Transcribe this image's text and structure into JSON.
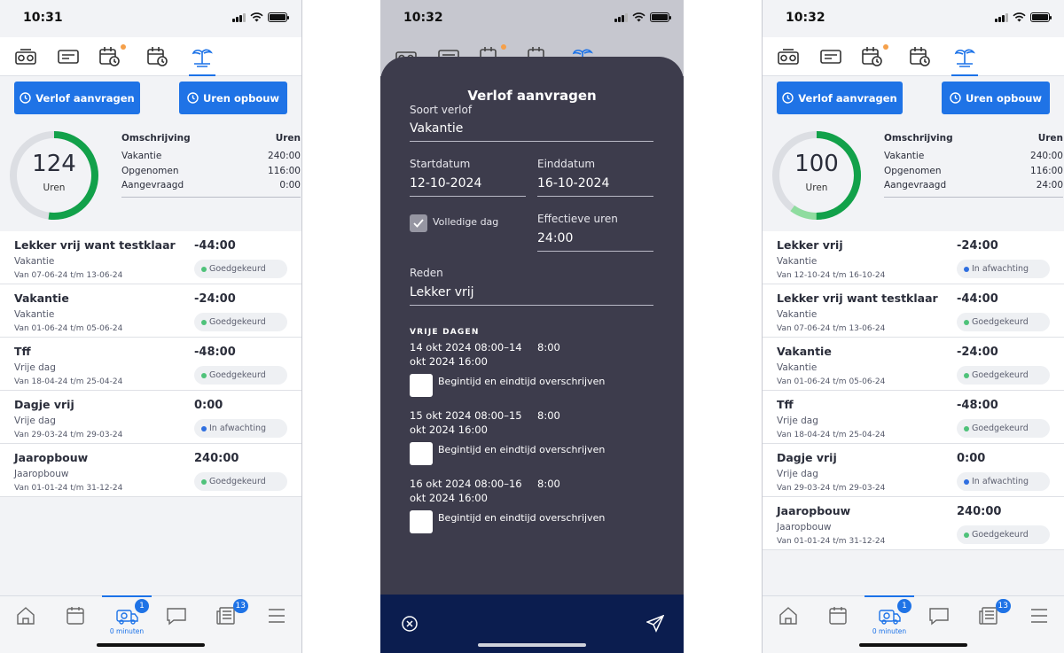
{
  "screens": [
    {
      "time": "10:31",
      "buttons": {
        "request": "Verlof aanvragen",
        "accrual": "Uren opbouw"
      },
      "ring": {
        "value": "124",
        "label": "Uren",
        "progress": 0.52
      },
      "table": {
        "header": {
          "desc": "Omschrijving",
          "hours": "Uren"
        },
        "rows": [
          {
            "label": "Vakantie",
            "value": "240:00"
          },
          {
            "label": "Opgenomen",
            "value": "116:00"
          },
          {
            "label": "Aangevraagd",
            "value": "0:00"
          }
        ]
      },
      "items": [
        {
          "title": "Lekker vrij want testklaar",
          "type": "Vakantie",
          "dates": "Van 07-06-24 t/m 13-06-24",
          "value": "-44:00",
          "status": "Goedgekeurd",
          "color": "#4fc27a"
        },
        {
          "title": "Vakantie",
          "type": "Vakantie",
          "dates": "Van 01-06-24 t/m 05-06-24",
          "value": "-24:00",
          "status": "Goedgekeurd",
          "color": "#4fc27a"
        },
        {
          "title": "Tff",
          "type": "Vrije dag",
          "dates": "Van 18-04-24 t/m 25-04-24",
          "value": "-48:00",
          "status": "Goedgekeurd",
          "color": "#4fc27a"
        },
        {
          "title": "Dagje vrij",
          "type": "Vrije dag",
          "dates": "Van 29-03-24 t/m 29-03-24",
          "value": "0:00",
          "status": "In afwachting",
          "color": "#2f6fe0"
        },
        {
          "title": "Jaaropbouw",
          "type": "Jaaropbouw",
          "dates": "Van 01-01-24 t/m 31-12-24",
          "value": "240:00",
          "status": "Goedgekeurd",
          "color": "#4fc27a"
        }
      ],
      "tabbar": {
        "badge_clock": "1",
        "clock_label": "0 minuten",
        "badge_news": "13"
      }
    },
    {
      "time": "10:32",
      "buttons": {
        "request": "Verlof aanvragen",
        "accrual": "Uren opbouw"
      },
      "ring": {
        "value": "100",
        "label": "Uren",
        "progress": 0.5,
        "pending": 0.1
      },
      "table": {
        "header": {
          "desc": "Omschrijving",
          "hours": "Uren"
        },
        "rows": [
          {
            "label": "Vakantie",
            "value": "240:00"
          },
          {
            "label": "Opgenomen",
            "value": "116:00"
          },
          {
            "label": "Aangevraagd",
            "value": "24:00"
          }
        ]
      },
      "items": [
        {
          "title": "Lekker vrij",
          "type": "Vakantie",
          "dates": "Van 12-10-24 t/m 16-10-24",
          "value": "-24:00",
          "status": "In afwachting",
          "color": "#2f6fe0"
        },
        {
          "title": "Lekker vrij want testklaar",
          "type": "Vakantie",
          "dates": "Van 07-06-24 t/m 13-06-24",
          "value": "-44:00",
          "status": "Goedgekeurd",
          "color": "#4fc27a"
        },
        {
          "title": "Vakantie",
          "type": "Vakantie",
          "dates": "Van 01-06-24 t/m 05-06-24",
          "value": "-24:00",
          "status": "Goedgekeurd",
          "color": "#4fc27a"
        },
        {
          "title": "Tff",
          "type": "Vrije dag",
          "dates": "Van 18-04-24 t/m 25-04-24",
          "value": "-48:00",
          "status": "Goedgekeurd",
          "color": "#4fc27a"
        },
        {
          "title": "Dagje vrij",
          "type": "Vrije dag",
          "dates": "Van 29-03-24 t/m 29-03-24",
          "value": "0:00",
          "status": "In afwachting",
          "color": "#2f6fe0"
        },
        {
          "title": "Jaaropbouw",
          "type": "Jaaropbouw",
          "dates": "Van 01-01-24 t/m 31-12-24",
          "value": "240:00",
          "status": "Goedgekeurd",
          "color": "#4fc27a"
        }
      ],
      "tabbar": {
        "badge_clock": "1",
        "clock_label": "0 minuten",
        "badge_news": "13"
      }
    }
  ],
  "modal": {
    "time": "10:32",
    "title": "Verlof aanvragen",
    "type_label": "Soort verlof",
    "type_value": "Vakantie",
    "start_label": "Startdatum",
    "start_value": "12-10-2024",
    "end_label": "Einddatum",
    "end_value": "16-10-2024",
    "fullday_label": "Volledige dag",
    "fullday_checked": true,
    "effective_label": "Effectieve uren",
    "effective_value": "24:00",
    "reason_label": "Reden",
    "reason_value": "Lekker vrij",
    "section": "VRIJE DAGEN",
    "days": [
      {
        "range_line1": "14 okt 2024 08:00–14",
        "range_line2": "okt 2024 16:00",
        "hours": "8:00",
        "override": "Begintijd en eindtijd overschrijven"
      },
      {
        "range_line1": "15 okt 2024 08:00–15",
        "range_line2": "okt 2024 16:00",
        "hours": "8:00",
        "override": "Begintijd en eindtijd overschrijven"
      },
      {
        "range_line1": "16 okt 2024 08:00–16",
        "range_line2": "okt 2024 16:00",
        "hours": "8:00",
        "override": "Begintijd en eindtijd overschrijven"
      }
    ]
  },
  "colors": {
    "accent": "#1f73e6",
    "approved": "#4fc27a",
    "pending": "#2f6fe0",
    "ring_green": "#12a14a",
    "modal_bg": "#3d3c4c",
    "footer": "#0b1d4f"
  }
}
